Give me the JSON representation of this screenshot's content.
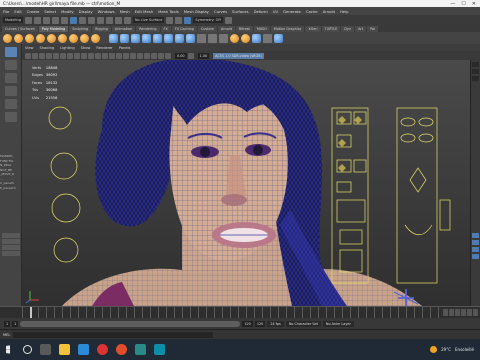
{
  "window": {
    "title": "C:\\Users\\...\\model\\HR girl\\maya file.mb  —  ctrl\\motion_M",
    "controls": [
      "—",
      "☐",
      "✕"
    ]
  },
  "menus": [
    "File",
    "Edit",
    "Create",
    "Select",
    "Modify",
    "Display",
    "Windows",
    "Mesh",
    "Edit Mesh",
    "Mesh Tools",
    "Mesh Display",
    "Curves",
    "Surfaces",
    "Deform",
    "UV",
    "Generate",
    "Cache",
    "Arnold",
    "Help"
  ],
  "status": {
    "workspace": "Modeling",
    "no_live_surface": "No Live Surface",
    "symmetry": "Symmetry: Off"
  },
  "shelf_tabs": [
    "Curves / Surfaces",
    "Poly Modeling",
    "Sculpting",
    "Rigging",
    "Animation",
    "Rendering",
    "FX",
    "FX Caching",
    "Custom",
    "Arnold",
    "Bifrost",
    "MASH",
    "Motion Graphics",
    "XGen",
    "TURTLE",
    "Dyn",
    "Art",
    "Pai"
  ],
  "shelf_active": "Poly Modeling",
  "panel_menu": [
    "View",
    "Shading",
    "Lighting",
    "Show",
    "Renderer",
    "Panels"
  ],
  "panel_fields": {
    "near": "0.00",
    "far": "1.00",
    "color_space": "ACES 1.0 SDR-video (sRGB)"
  },
  "hud": [
    {
      "label": "Verts",
      "value": "18848"
    },
    {
      "label": "Edges",
      "value": "36092"
    },
    {
      "label": "Faces",
      "value": "18132"
    },
    {
      "label": "Tris",
      "value": "36068"
    },
    {
      "label": "UVs",
      "value": "21556"
    }
  ],
  "toolbox_text": [
    "MANDEL",
    "FUNCTIO",
    "N_REAL",
    "NOT_BE",
    "_MOVE_R",
    "...",
    "C_panelS",
    "P_panelCh"
  ],
  "range": {
    "start": "1",
    "end": "120",
    "anim_start": "1",
    "anim_end": "120",
    "fps": "24 fps",
    "character_set": "No Character Set",
    "anim_layer": "No Anim Layer"
  },
  "command": {
    "lang": "MEL"
  },
  "taskbar": {
    "weather_temp": "29°C",
    "weather_label": "Ensoleillé"
  }
}
